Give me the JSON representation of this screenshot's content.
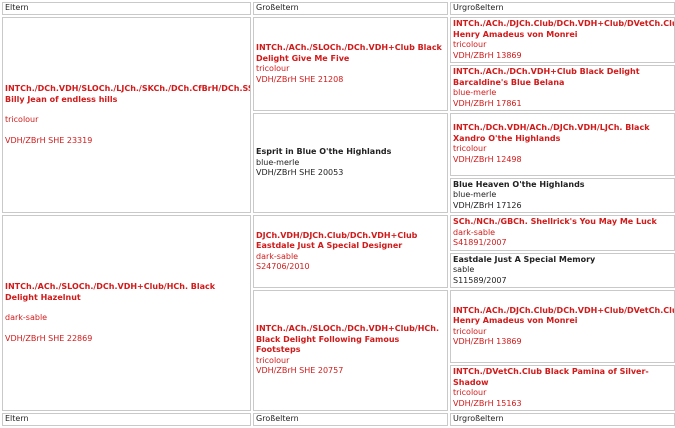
{
  "headers": {
    "parents": "Eltern",
    "grandparents": "Großeltern",
    "greatgrandparents": "Urgroßeltern"
  },
  "parents": [
    {
      "name": "INTCh./DCh.VDH/SLOCh./LJCh./SKCh./DCh.CfBrH/DCh.SSCD Billy Jean of endless hills",
      "color": "tricolour",
      "reg": "VDH/ZBrH SHE 23319",
      "tone": "red"
    },
    {
      "name": "INTCh./ACh./SLOCh./DCh.VDH+Club/HCh. Black Delight Hazelnut",
      "color": "dark-sable",
      "reg": "VDH/ZBrH SHE 22869",
      "tone": "red"
    }
  ],
  "grandparents": [
    {
      "name": "INTCh./ACh./SLOCh./DCh.VDH+Club Black Delight Give Me Five",
      "color": "tricolour",
      "reg": "VDH/ZBrH SHE 21208",
      "tone": "red"
    },
    {
      "name": "Esprit in Blue O'the Highlands",
      "color": "blue-merle",
      "reg": "VDH/ZBrH SHE 20053",
      "tone": "black"
    },
    {
      "name": "DJCh.VDH/DJCh.Club/DCh.VDH+Club Eastdale Just A Special Designer",
      "color": "dark-sable",
      "reg": "S24706/2010",
      "tone": "red"
    },
    {
      "name": "INTCh./ACh./SLOCh./DCh.VDH+Club/HCh. Black Delight Following Famous Footsteps",
      "color": "tricolour",
      "reg": "VDH/ZBrH SHE 20757",
      "tone": "red"
    }
  ],
  "greatgrandparents": [
    {
      "name": "INTCh./ACh./DJCh.Club/DCh.VDH+Club/DVetCh.Club Henry Amadeus von Monrei",
      "color": "tricolour",
      "reg": "VDH/ZBrH 13869",
      "tone": "red"
    },
    {
      "name": "INTCh./ACh./DCh.VDH+Club Black Delight Barcaldine's Blue Belana",
      "color": "blue-merle",
      "reg": "VDH/ZBrH 17861",
      "tone": "red"
    },
    {
      "name": "INTCh./DCh.VDH/ACh./DJCh.VDH/LJCh. Black Xandro O'the Highlands",
      "color": "tricolour",
      "reg": "VDH/ZBrH 12498",
      "tone": "red"
    },
    {
      "name": "Blue Heaven O'the Highlands",
      "color": "blue-merle",
      "reg": "VDH/ZBrH 17126",
      "tone": "black"
    },
    {
      "name": "SCh./NCh./GBCh. Shellrick's You May Me Luck",
      "color": "dark-sable",
      "reg": "S41891/2007",
      "tone": "red"
    },
    {
      "name": "Eastdale Just A Special Memory",
      "color": "sable",
      "reg": "S11589/2007",
      "tone": "black"
    },
    {
      "name": "INTCh./ACh./DJCh.Club/DCh.VDH+Club/DVetCh.Club Henry Amadeus von Monrei",
      "color": "tricolour",
      "reg": "VDH/ZBrH 13869",
      "tone": "red"
    },
    {
      "name": "INTCh./DVetCh.Club Black Pamina of Silver-Shadow",
      "color": "tricolour",
      "reg": "VDH/ZBrH 15163",
      "tone": "red"
    }
  ]
}
